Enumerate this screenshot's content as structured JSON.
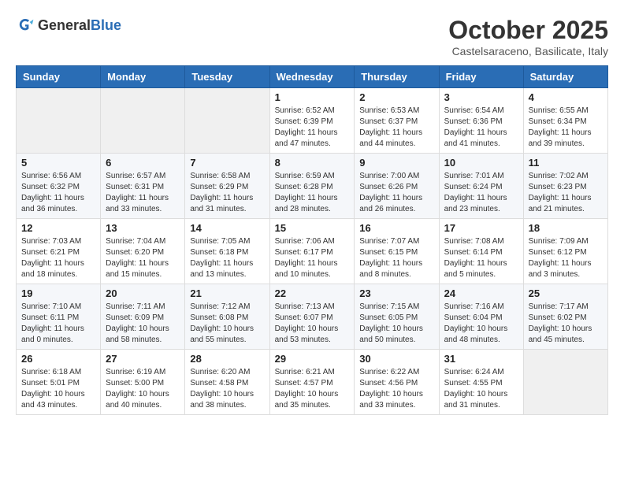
{
  "header": {
    "logo_general": "General",
    "logo_blue": "Blue",
    "month_title": "October 2025",
    "location": "Castelsaraceno, Basilicate, Italy"
  },
  "weekdays": [
    "Sunday",
    "Monday",
    "Tuesday",
    "Wednesday",
    "Thursday",
    "Friday",
    "Saturday"
  ],
  "weeks": [
    [
      {
        "day": "",
        "info": ""
      },
      {
        "day": "",
        "info": ""
      },
      {
        "day": "",
        "info": ""
      },
      {
        "day": "1",
        "info": "Sunrise: 6:52 AM\nSunset: 6:39 PM\nDaylight: 11 hours\nand 47 minutes."
      },
      {
        "day": "2",
        "info": "Sunrise: 6:53 AM\nSunset: 6:37 PM\nDaylight: 11 hours\nand 44 minutes."
      },
      {
        "day": "3",
        "info": "Sunrise: 6:54 AM\nSunset: 6:36 PM\nDaylight: 11 hours\nand 41 minutes."
      },
      {
        "day": "4",
        "info": "Sunrise: 6:55 AM\nSunset: 6:34 PM\nDaylight: 11 hours\nand 39 minutes."
      }
    ],
    [
      {
        "day": "5",
        "info": "Sunrise: 6:56 AM\nSunset: 6:32 PM\nDaylight: 11 hours\nand 36 minutes."
      },
      {
        "day": "6",
        "info": "Sunrise: 6:57 AM\nSunset: 6:31 PM\nDaylight: 11 hours\nand 33 minutes."
      },
      {
        "day": "7",
        "info": "Sunrise: 6:58 AM\nSunset: 6:29 PM\nDaylight: 11 hours\nand 31 minutes."
      },
      {
        "day": "8",
        "info": "Sunrise: 6:59 AM\nSunset: 6:28 PM\nDaylight: 11 hours\nand 28 minutes."
      },
      {
        "day": "9",
        "info": "Sunrise: 7:00 AM\nSunset: 6:26 PM\nDaylight: 11 hours\nand 26 minutes."
      },
      {
        "day": "10",
        "info": "Sunrise: 7:01 AM\nSunset: 6:24 PM\nDaylight: 11 hours\nand 23 minutes."
      },
      {
        "day": "11",
        "info": "Sunrise: 7:02 AM\nSunset: 6:23 PM\nDaylight: 11 hours\nand 21 minutes."
      }
    ],
    [
      {
        "day": "12",
        "info": "Sunrise: 7:03 AM\nSunset: 6:21 PM\nDaylight: 11 hours\nand 18 minutes."
      },
      {
        "day": "13",
        "info": "Sunrise: 7:04 AM\nSunset: 6:20 PM\nDaylight: 11 hours\nand 15 minutes."
      },
      {
        "day": "14",
        "info": "Sunrise: 7:05 AM\nSunset: 6:18 PM\nDaylight: 11 hours\nand 13 minutes."
      },
      {
        "day": "15",
        "info": "Sunrise: 7:06 AM\nSunset: 6:17 PM\nDaylight: 11 hours\nand 10 minutes."
      },
      {
        "day": "16",
        "info": "Sunrise: 7:07 AM\nSunset: 6:15 PM\nDaylight: 11 hours\nand 8 minutes."
      },
      {
        "day": "17",
        "info": "Sunrise: 7:08 AM\nSunset: 6:14 PM\nDaylight: 11 hours\nand 5 minutes."
      },
      {
        "day": "18",
        "info": "Sunrise: 7:09 AM\nSunset: 6:12 PM\nDaylight: 11 hours\nand 3 minutes."
      }
    ],
    [
      {
        "day": "19",
        "info": "Sunrise: 7:10 AM\nSunset: 6:11 PM\nDaylight: 11 hours\nand 0 minutes."
      },
      {
        "day": "20",
        "info": "Sunrise: 7:11 AM\nSunset: 6:09 PM\nDaylight: 10 hours\nand 58 minutes."
      },
      {
        "day": "21",
        "info": "Sunrise: 7:12 AM\nSunset: 6:08 PM\nDaylight: 10 hours\nand 55 minutes."
      },
      {
        "day": "22",
        "info": "Sunrise: 7:13 AM\nSunset: 6:07 PM\nDaylight: 10 hours\nand 53 minutes."
      },
      {
        "day": "23",
        "info": "Sunrise: 7:15 AM\nSunset: 6:05 PM\nDaylight: 10 hours\nand 50 minutes."
      },
      {
        "day": "24",
        "info": "Sunrise: 7:16 AM\nSunset: 6:04 PM\nDaylight: 10 hours\nand 48 minutes."
      },
      {
        "day": "25",
        "info": "Sunrise: 7:17 AM\nSunset: 6:02 PM\nDaylight: 10 hours\nand 45 minutes."
      }
    ],
    [
      {
        "day": "26",
        "info": "Sunrise: 6:18 AM\nSunset: 5:01 PM\nDaylight: 10 hours\nand 43 minutes."
      },
      {
        "day": "27",
        "info": "Sunrise: 6:19 AM\nSunset: 5:00 PM\nDaylight: 10 hours\nand 40 minutes."
      },
      {
        "day": "28",
        "info": "Sunrise: 6:20 AM\nSunset: 4:58 PM\nDaylight: 10 hours\nand 38 minutes."
      },
      {
        "day": "29",
        "info": "Sunrise: 6:21 AM\nSunset: 4:57 PM\nDaylight: 10 hours\nand 35 minutes."
      },
      {
        "day": "30",
        "info": "Sunrise: 6:22 AM\nSunset: 4:56 PM\nDaylight: 10 hours\nand 33 minutes."
      },
      {
        "day": "31",
        "info": "Sunrise: 6:24 AM\nSunset: 4:55 PM\nDaylight: 10 hours\nand 31 minutes."
      },
      {
        "day": "",
        "info": ""
      }
    ]
  ]
}
